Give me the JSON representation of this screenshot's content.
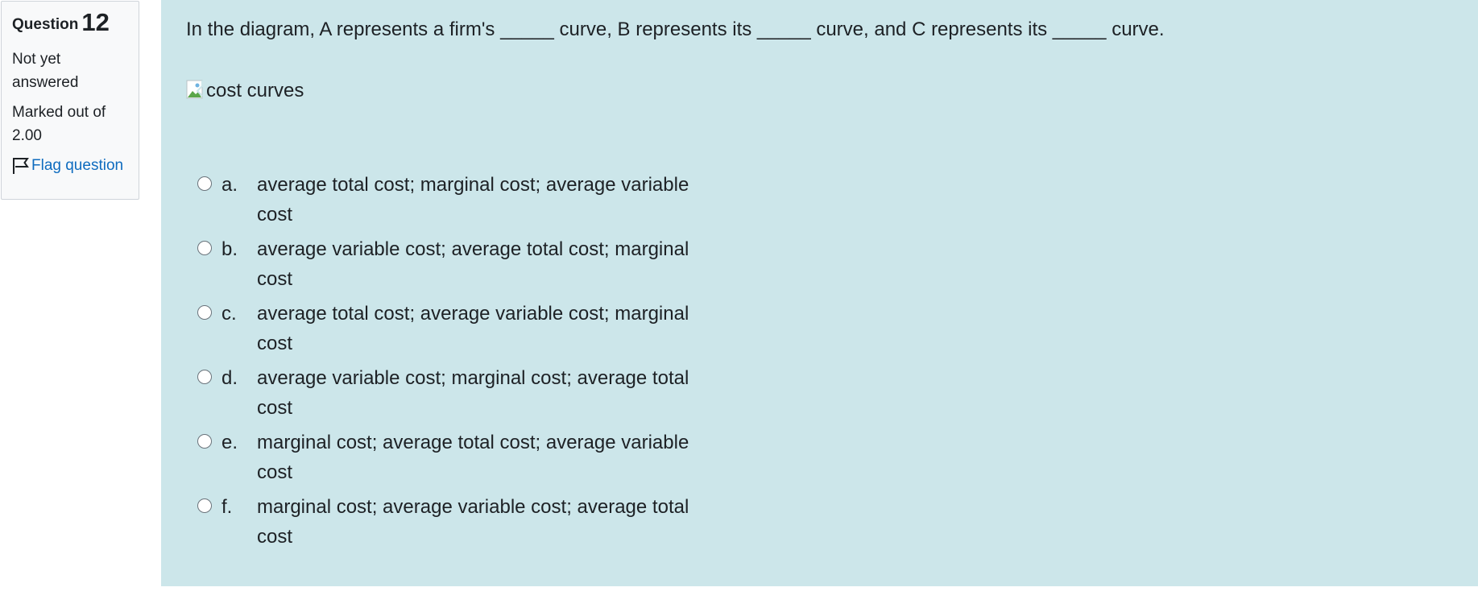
{
  "info": {
    "question_word": "Question",
    "question_number": "12",
    "state": "Not yet answered",
    "grade": "Marked out of 2.00",
    "flag_label": "Flag question"
  },
  "question": {
    "text": "In the diagram, A represents a firm's _____ curve, B represents its _____ curve, and C represents its _____ curve.",
    "image_alt": "cost curves"
  },
  "answers": [
    {
      "letter": "a.",
      "text": "average total cost; marginal cost; average variable cost"
    },
    {
      "letter": "b.",
      "text": "average variable cost; average total cost; marginal cost"
    },
    {
      "letter": "c.",
      "text": "average total cost; average variable cost; marginal cost"
    },
    {
      "letter": "d.",
      "text": "average variable cost; marginal cost; average total cost"
    },
    {
      "letter": "e.",
      "text": "marginal cost; average total cost; average variable cost"
    },
    {
      "letter": "f.",
      "text": "marginal cost; average variable cost; average total cost"
    }
  ],
  "colors": {
    "content_bg": "#cce6ea",
    "info_bg": "#f8f9fa",
    "link": "#0f6cbf"
  }
}
